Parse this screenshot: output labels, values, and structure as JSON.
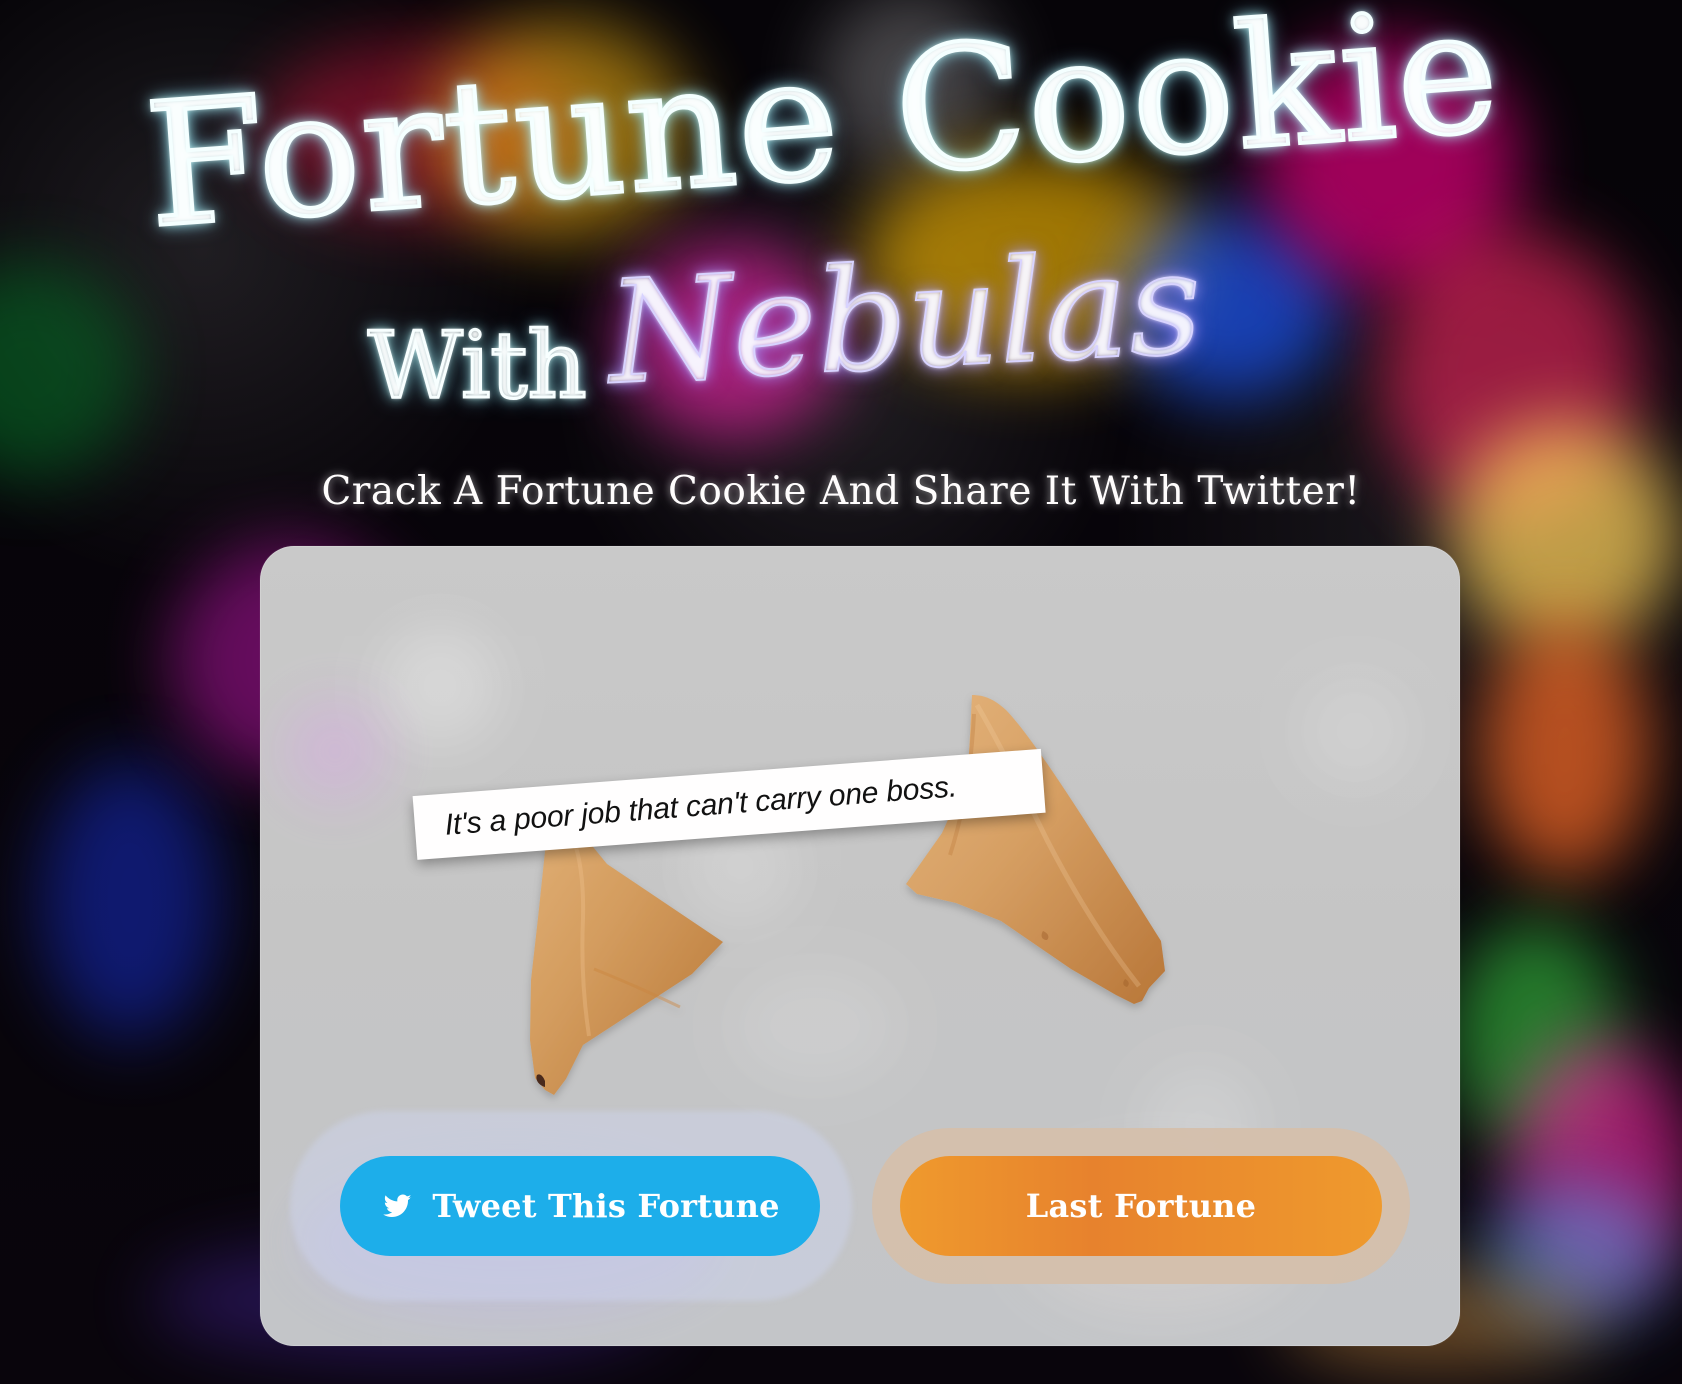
{
  "hero": {
    "title_line_1": "Fortune Cookie",
    "title_word_with": "With",
    "title_word_nebulas": "Nebulas",
    "subtitle": "Crack A Fortune Cookie And Share It With Twitter!"
  },
  "fortune": {
    "message": "It's a poor job that can't carry one boss."
  },
  "actions": {
    "tweet_label": "Tweet This Fortune",
    "last_label": "Last Fortune",
    "tweet_icon": "twitter-bird-icon"
  },
  "colors": {
    "tweet_button": "#1daeea",
    "last_button_start": "#ef9a2d",
    "last_button_end": "#e7822d",
    "card_background": "#c7c7c7",
    "title_glow": "#bfffff",
    "nebula_glow": "#c8bfff"
  }
}
